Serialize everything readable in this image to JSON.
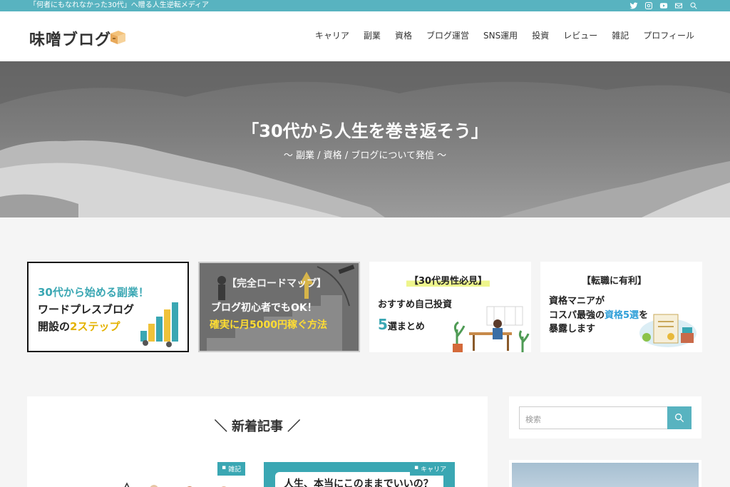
{
  "topbar": {
    "tagline": "「何者にもなれなかった30代」へ贈る人生逆転メディア",
    "icons": [
      "twitter-icon",
      "instagram-icon",
      "youtube-icon",
      "mail-icon",
      "search-icon"
    ]
  },
  "header": {
    "logo": "味噌ブログ",
    "nav": [
      "キャリア",
      "副業",
      "資格",
      "ブログ運営",
      "SNS運用",
      "投資",
      "レビュー",
      "雑記",
      "プロフィール"
    ]
  },
  "hero": {
    "title": "「30代から人生を巻き返そう」",
    "subtitle": "〜 副業 / 資格 / ブログについて発信 〜"
  },
  "banners": {
    "b1": {
      "line1": "30代から始める副業！",
      "line2": "ワードプレスブログ",
      "line3_pre": "開設の",
      "line3_hl": "2ステップ"
    },
    "b2": {
      "line1": "【完全ロードマップ】",
      "line2": "ブログ初心者でもOK！",
      "line3": "確実に月5000円稼ぐ方法"
    },
    "b3": {
      "line1": "【30代男性必見】",
      "line2": "おすすめ自己投資",
      "line3_num": "5",
      "line3_rest": "選まとめ"
    },
    "b4": {
      "line1": "【転職に有利】",
      "line2": "資格マニアが",
      "line3_pre": "コスパ最強の",
      "line3_hl": "資格5選",
      "line3_post": "を",
      "line4": "暴露します"
    }
  },
  "main": {
    "section_title": "＼ 新着記事 ／",
    "posts": [
      {
        "category": "雑記"
      },
      {
        "category": "キャリア",
        "thumb_title": "人生、本当にこのままでいいの？"
      }
    ]
  },
  "sidebar": {
    "search_placeholder": "検索"
  },
  "colors": {
    "accent": "#58b3c0",
    "teal_text": "#3aa7b3",
    "yellow": "#ffdd33"
  }
}
